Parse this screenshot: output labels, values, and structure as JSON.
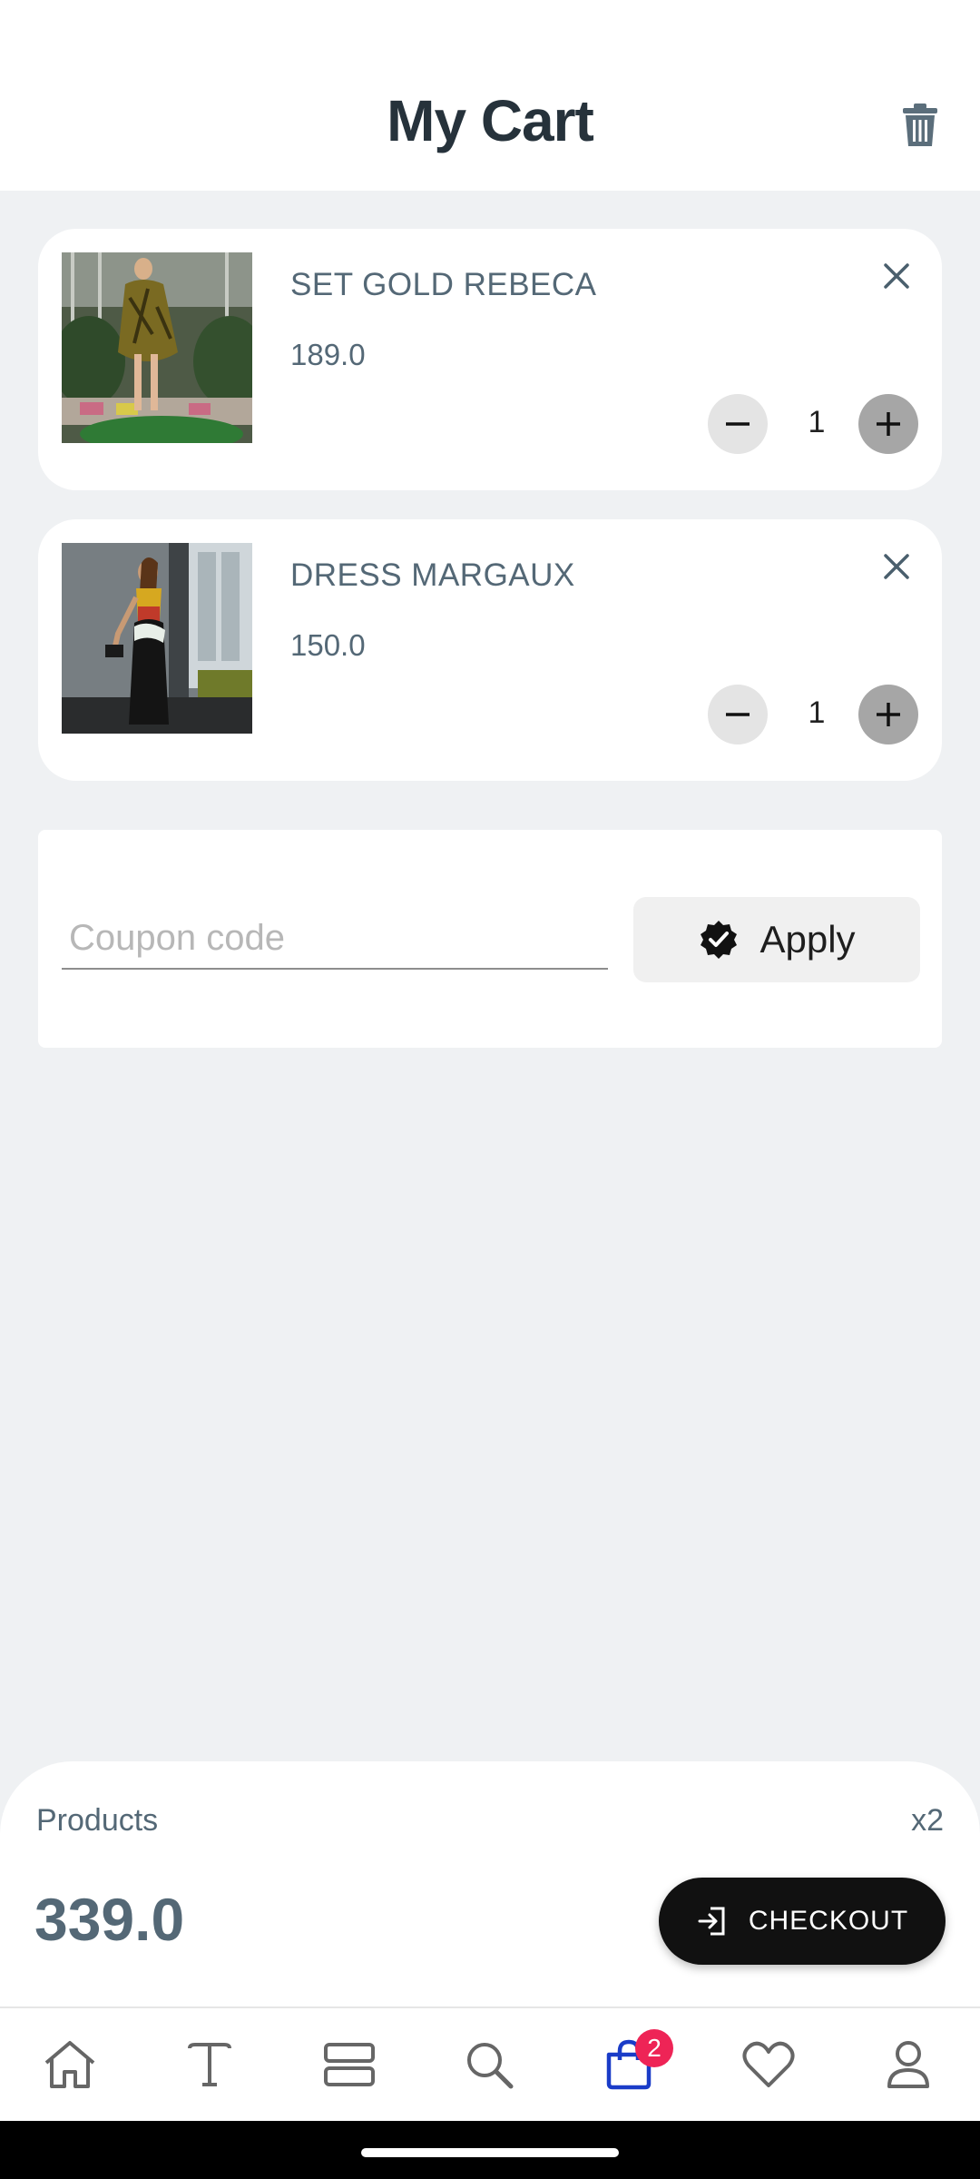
{
  "header": {
    "title": "My Cart",
    "trash_icon": "trash-icon"
  },
  "cart_items": [
    {
      "name": "SET GOLD REBECA",
      "price": "189.0",
      "quantity": "1"
    },
    {
      "name": "DRESS MARGAUX",
      "price": "150.0",
      "quantity": "1"
    }
  ],
  "coupon": {
    "placeholder": "Coupon code",
    "value": "",
    "apply_label": "Apply"
  },
  "summary": {
    "products_label": "Products",
    "count": "x2",
    "total": "339.0",
    "checkout_label": "CHECKOUT"
  },
  "bottom_nav": {
    "items": [
      "home-icon",
      "text-icon",
      "layers-icon",
      "search-icon",
      "cart-icon",
      "heart-icon",
      "profile-icon"
    ],
    "cart_badge": "2",
    "active_color": "#1a3cc8",
    "badge_color": "#ee2456"
  },
  "colors": {
    "background": "#eff1f3",
    "text_muted": "#546876",
    "checkout": "#111111"
  }
}
